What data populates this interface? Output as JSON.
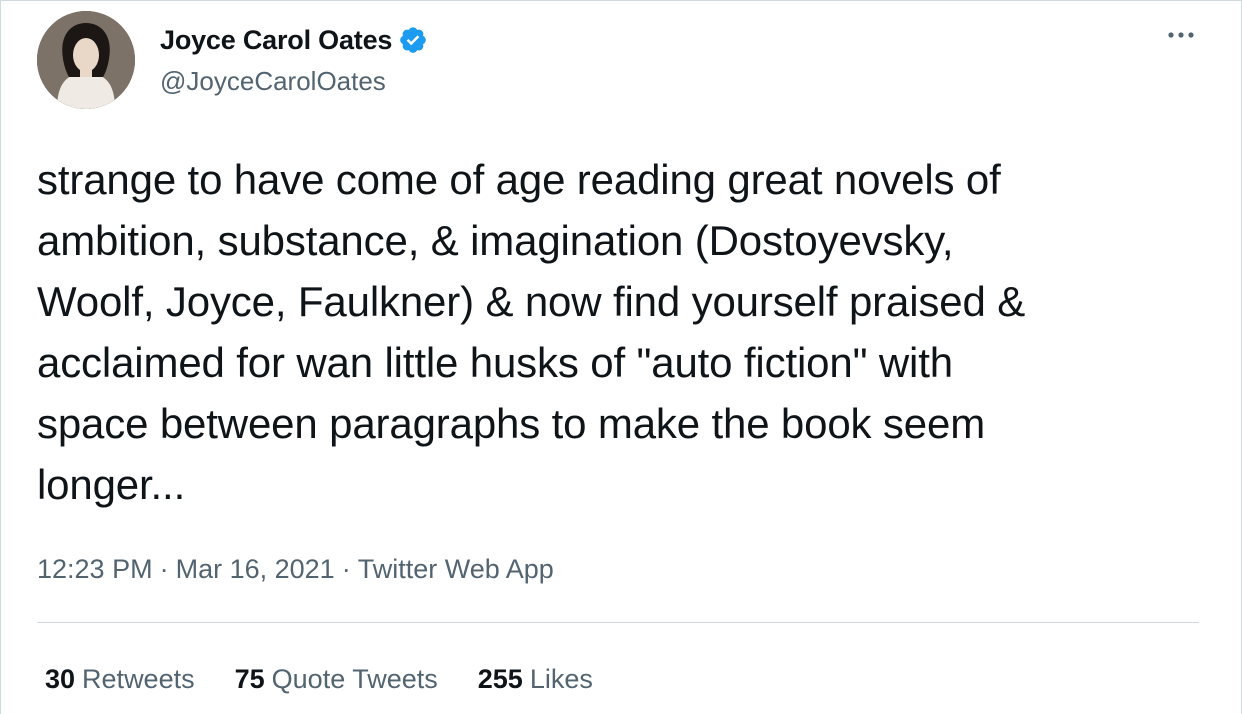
{
  "author": {
    "display_name": "Joyce Carol Oates",
    "handle": "@JoyceCarolOates",
    "verified_icon": "verified-badge-icon",
    "avatar_icon": "avatar"
  },
  "tweet": {
    "text": "strange to have come of age reading great novels of\nambition, substance, & imagination (Dostoyevsky,\nWoolf, Joyce, Faulkner) & now find yourself praised &\nacclaimed for wan little husks of \"auto fiction\" with\nspace between paragraphs to make the book seem\nlonger..."
  },
  "meta": {
    "time": "12:23 PM",
    "separator": "·",
    "date": "Mar 16, 2021",
    "source": "Twitter Web App"
  },
  "stats": {
    "retweets": {
      "count": "30",
      "label": "Retweets"
    },
    "quote_tweets": {
      "count": "75",
      "label": "Quote Tweets"
    },
    "likes": {
      "count": "255",
      "label": "Likes"
    }
  },
  "colors": {
    "text_primary": "#0f1419",
    "text_secondary": "#536471",
    "verified_blue": "#1d9bf0",
    "divider": "#cfd9de"
  },
  "icons": {
    "more": "more-horizontal-icon"
  }
}
